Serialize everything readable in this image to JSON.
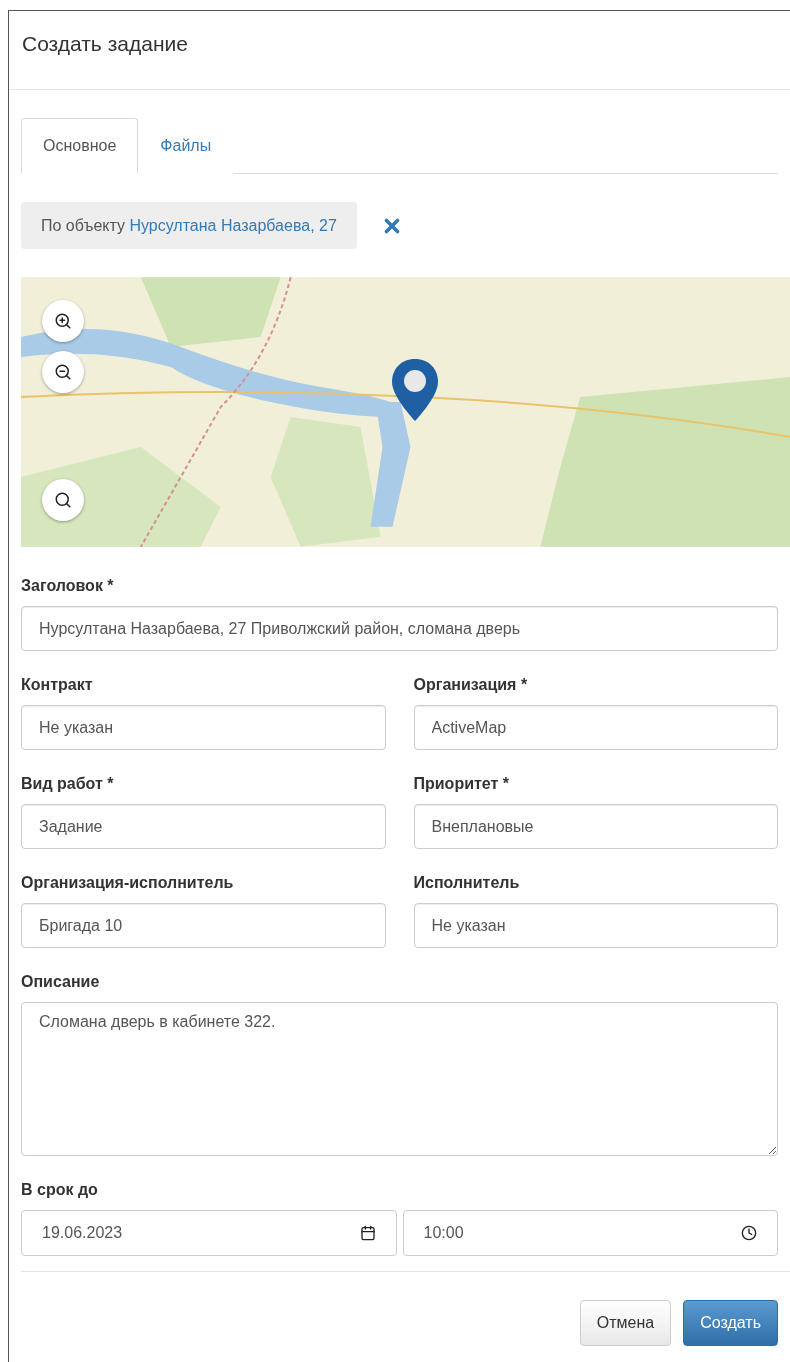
{
  "dialog": {
    "title": "Создать задание"
  },
  "tabs": [
    {
      "label": "Основное",
      "selected": true
    },
    {
      "label": "Файлы",
      "selected": false
    }
  ],
  "object_filter": {
    "prefix": "По объекту",
    "link": "Нурсултана Назарбаева, 27"
  },
  "form_rows": [
    [
      {
        "label": "Заголовок *",
        "value": "Нурсултана Назарбаева, 27 Приволжский район, сломана дверь",
        "kind": "input"
      }
    ],
    [
      {
        "label": "Контракт",
        "value": "Не указан",
        "kind": "input"
      },
      {
        "label": "Организация *",
        "value": "ActiveMap",
        "kind": "input"
      }
    ],
    [
      {
        "label": "Вид работ *",
        "value": "Задание",
        "kind": "input"
      },
      {
        "label": "Приоритет *",
        "value": "Внеплановые",
        "kind": "input"
      }
    ],
    [
      {
        "label": "Организация-исполнитель",
        "value": "Бригада 10",
        "kind": "input"
      },
      {
        "label": "Исполнитель",
        "value": "Не указан",
        "kind": "input"
      }
    ],
    [
      {
        "label": "Описание",
        "value": "Сломана дверь в кабинете 322.",
        "kind": "textarea"
      }
    ]
  ],
  "deadline": {
    "label": "В срок до",
    "date": "19.06.2023",
    "time": "10:00"
  },
  "buttons": [
    {
      "label": "Отмена",
      "kind": "default"
    },
    {
      "label": "Создать",
      "kind": "primary"
    }
  ]
}
